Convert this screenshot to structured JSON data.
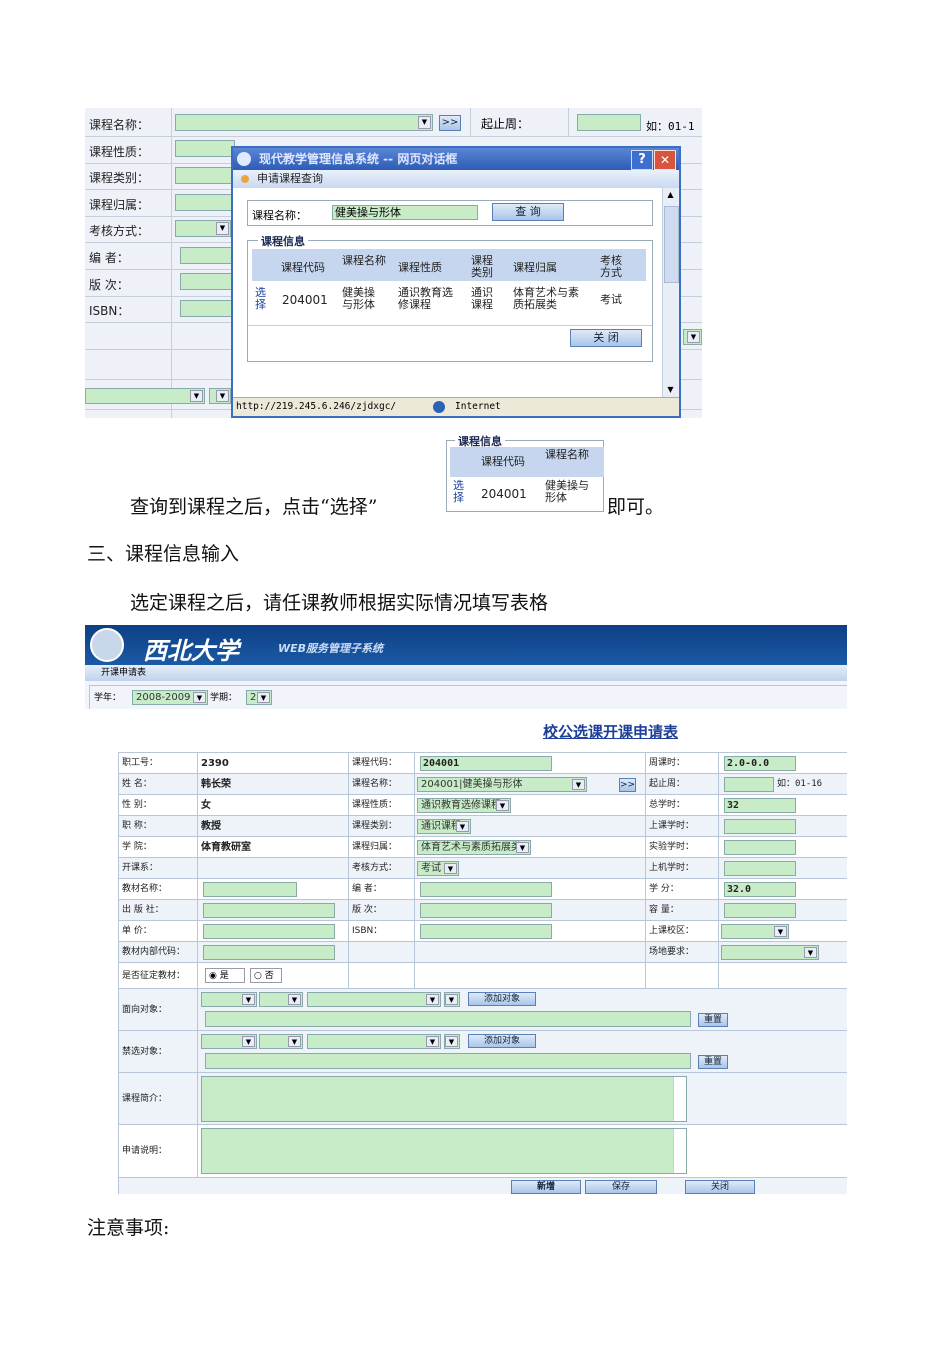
{
  "screenshot1": {
    "form_labels": [
      "课程名称：",
      "课程性质：",
      "课程类别：",
      "课程归属：",
      "考核方式：",
      "编  者：",
      "版  次：",
      "ISBN："
    ],
    "next_button": ">>",
    "right_label": "起止周：",
    "right_hint": "如：01-1",
    "dialog": {
      "title": "现代教学管理信息系统 -- 网页对话框",
      "help": "?",
      "close": "✕",
      "subtitle": "申请课程查询",
      "search_label": "课程名称：",
      "search_value": "健美操与形体",
      "query_button": "查 询",
      "section_title": "课程信息",
      "columns": [
        "课程代码",
        "课程名称",
        "课程性质",
        "课程类别",
        "课程归属",
        "考核方式"
      ],
      "row": {
        "select": "选择",
        "code": "204001",
        "name": "健美操与形体",
        "nature": "通识教育选修课程",
        "category": "通识课程",
        "belong": "体育艺术与素质拓展类",
        "exam": "考试"
      },
      "close_button": "关 闭",
      "status_url": "http://219.245.6.246/zjdxgc/",
      "status_zone": "Internet"
    }
  },
  "snippet": {
    "section_title": "课程信息",
    "col1": "课程代码",
    "col2": "课程名称",
    "select": "选择",
    "code": "204001",
    "name": "健美操与形体"
  },
  "text": {
    "p1_before": "查询到课程之后，点击“选择”",
    "p1_after": "即可。",
    "heading3": "三、课程信息输入",
    "p2": "选定课程之后，请任课教师根据实际情况填写表格",
    "notes": "注意事项:"
  },
  "screenshot2": {
    "logo_text": "西北大学",
    "system_name": "WEB服务管理子系统",
    "breadcrumb": "开课申请表",
    "year_label": "学年：",
    "year_value": "2008-2009",
    "term_label": "学期：",
    "term_value": "2",
    "form_title": "校公选课开课申请表",
    "rows": [
      [
        [
          "职工号：",
          "2390",
          "text"
        ],
        [
          "课程代码：",
          "204001",
          "input"
        ],
        [
          "周课时：",
          "2.0-0.0",
          "input"
        ]
      ],
      [
        [
          "姓  名：",
          "韩长荣",
          "text"
        ],
        [
          "课程名称：",
          "204001|健美操与形体",
          "select"
        ],
        [
          "起止周：",
          "",
          "input"
        ]
      ],
      [
        [
          "性  别：",
          "女",
          "text"
        ],
        [
          "课程性质：",
          "通识教育选修课程",
          "select"
        ],
        [
          "总学时：",
          "32",
          "input"
        ]
      ],
      [
        [
          "职  称：",
          "教授",
          "text"
        ],
        [
          "课程类别：",
          "通识课程",
          "select"
        ],
        [
          "上课学时：",
          "",
          "input"
        ]
      ],
      [
        [
          "学  院：",
          "体育教研室",
          "text"
        ],
        [
          "课程归属：",
          "体育艺术与素质拓展类",
          "select"
        ],
        [
          "实验学时：",
          "",
          "input"
        ]
      ],
      [
        [
          "开课系：",
          "",
          "text"
        ],
        [
          "考核方式：",
          "考试",
          "select"
        ],
        [
          "上机学时：",
          "",
          "input"
        ]
      ],
      [
        [
          "教材名称：",
          "",
          "input"
        ],
        [
          "编  者：",
          "",
          "input"
        ],
        [
          "学  分：",
          "32.0",
          "input"
        ]
      ],
      [
        [
          "出 版 社：",
          "",
          "input"
        ],
        [
          "版  次：",
          "",
          "input"
        ],
        [
          "容  量：",
          "",
          "input"
        ]
      ],
      [
        [
          "单    价：",
          "",
          "input"
        ],
        [
          "ISBN：",
          "",
          "input"
        ],
        [
          "上课校区：",
          "",
          "select"
        ]
      ],
      [
        [
          "教材内部代码：",
          "",
          "input"
        ],
        [
          "",
          "",
          "none"
        ],
        [
          "场地要求：",
          "",
          "select"
        ]
      ]
    ],
    "week_hint": "如：01-16",
    "next_button": ">>",
    "textbook_label": "是否征定教材：",
    "yes": "是",
    "no": "否",
    "target_label": "面向对象：",
    "exclude_label": "禁选对象：",
    "add_target": "添加对象",
    "reset": "重置",
    "intro_label": "课程简介：",
    "note_label": "申请说明：",
    "btn_new": "新增",
    "btn_save": "保存",
    "btn_close": "关闭"
  }
}
